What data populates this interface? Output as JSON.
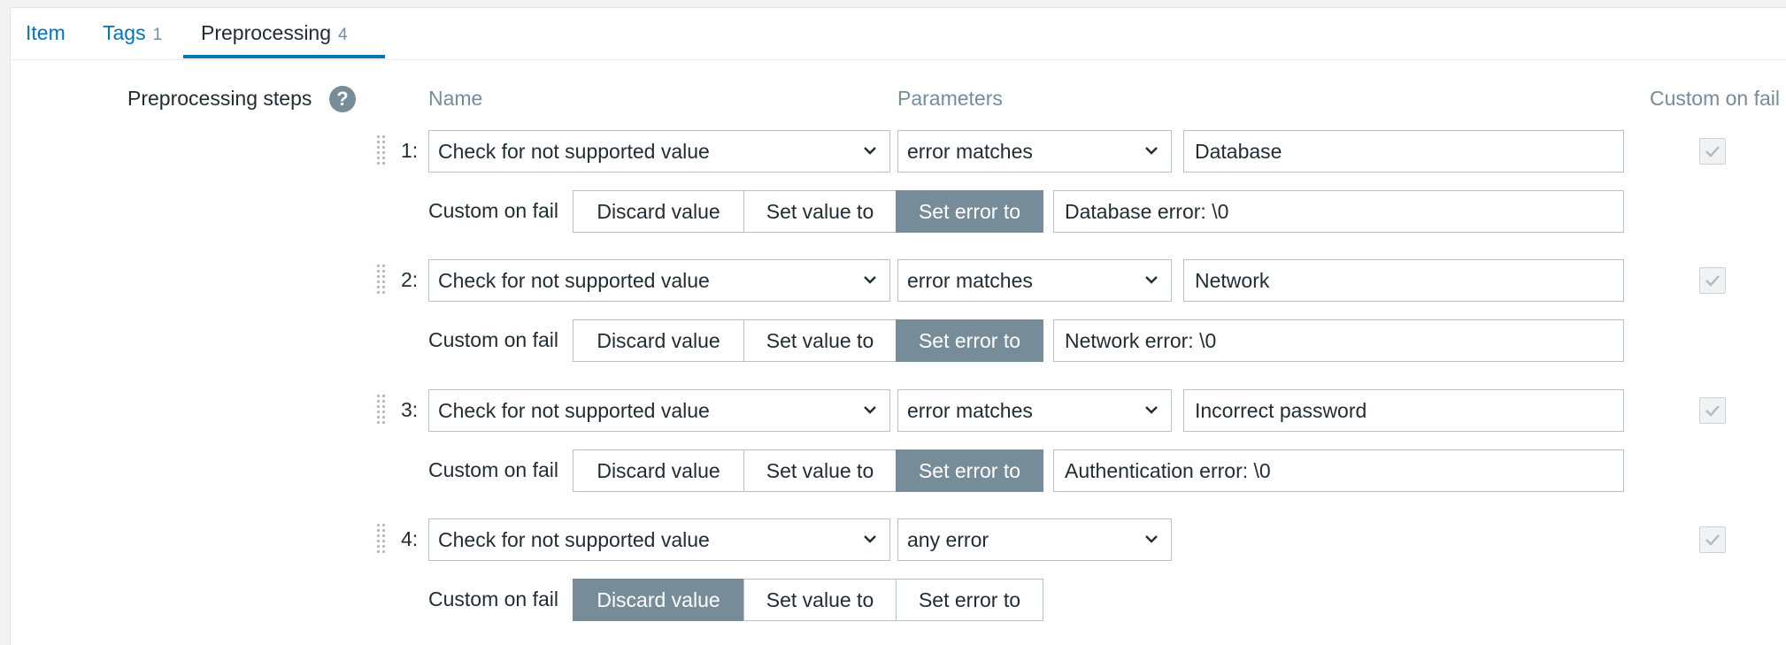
{
  "tabs": [
    {
      "label": "Item",
      "count": ""
    },
    {
      "label": "Tags",
      "count": "1"
    },
    {
      "label": "Preprocessing",
      "count": "4"
    }
  ],
  "preprocessing": {
    "label": "Preprocessing steps",
    "help_glyph": "?",
    "headers": {
      "name": "Name",
      "parameters": "Parameters",
      "custom_on_fail": "Custom on fail"
    },
    "custom_on_fail_label": "Custom on fail",
    "fail_options": [
      "Discard value",
      "Set value to",
      "Set error to"
    ],
    "steps": [
      {
        "num": "1:",
        "name": "Check for not supported value",
        "param_select": "error matches",
        "param_value": "Database",
        "fail_active": "Set error to",
        "fail_value": "Database error: \\0",
        "custom_on_fail_checked": true
      },
      {
        "num": "2:",
        "name": "Check for not supported value",
        "param_select": "error matches",
        "param_value": "Network",
        "fail_active": "Set error to",
        "fail_value": "Network error: \\0",
        "custom_on_fail_checked": true
      },
      {
        "num": "3:",
        "name": "Check for not supported value",
        "param_select": "error matches",
        "param_value": "Incorrect password",
        "fail_active": "Set error to",
        "fail_value": "Authentication error: \\0",
        "custom_on_fail_checked": true
      },
      {
        "num": "4:",
        "name": "Check for not supported value",
        "param_select": "any error",
        "param_value": "",
        "fail_active": "Discard value",
        "fail_value": "",
        "custom_on_fail_checked": true
      }
    ]
  },
  "icons": {
    "chevron": "chevron-down-icon",
    "checkbox": "check-icon",
    "drag": "drag-handle-icon",
    "help": "help-icon"
  },
  "colors": {
    "accent": "#0275b8",
    "active_segment": "#768d99",
    "muted_text": "#768d99"
  }
}
